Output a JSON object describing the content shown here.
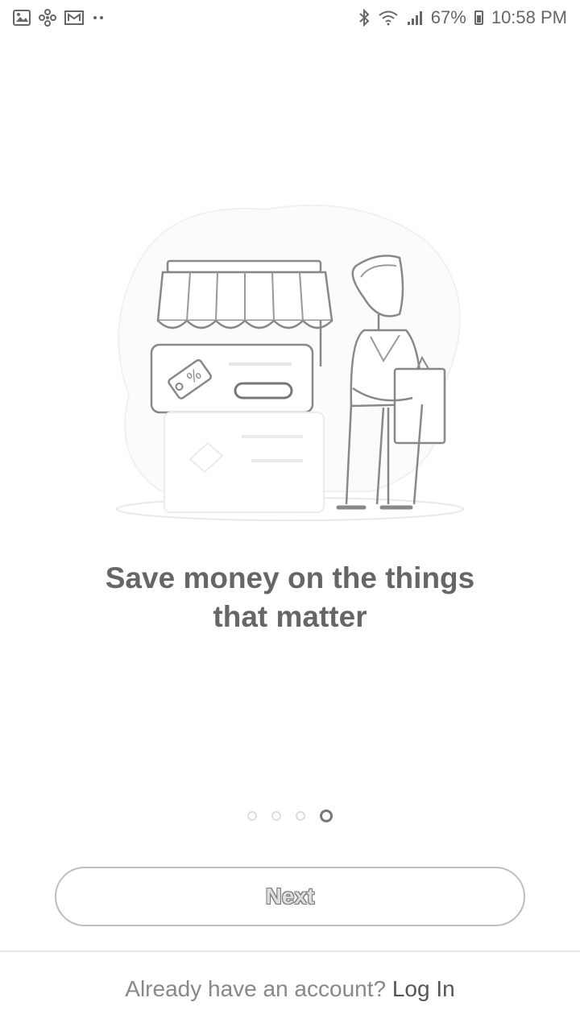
{
  "status_bar": {
    "left_icons": [
      "gallery-icon",
      "pinwheel-icon",
      "mail-icon",
      "more-dots-icon"
    ],
    "right_icons": [
      "bluetooth-icon",
      "wifi-icon",
      "signal-icon",
      "battery-icon"
    ],
    "battery_percent": "67%",
    "time": "10:58 PM"
  },
  "onboarding": {
    "headline_line1": "Save money on the things",
    "headline_line2": "that matter",
    "page_count": 4,
    "active_page": 4
  },
  "actions": {
    "next_label": "Next",
    "login_prompt": "Already have an account?",
    "login_link": "Log In"
  }
}
